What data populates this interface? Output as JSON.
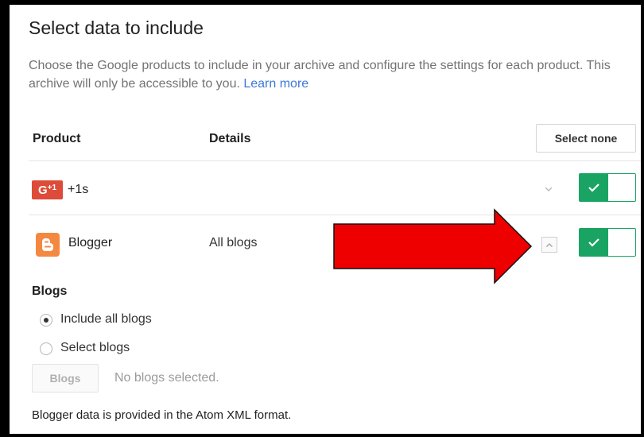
{
  "page": {
    "title": "Select data to include",
    "description": "Choose the Google products to include in your archive and configure the settings for each product. This archive will only be accessible to you.",
    "learn_more": "Learn more"
  },
  "table": {
    "headers": {
      "product": "Product",
      "details": "Details"
    },
    "select_none_label": "Select none",
    "rows": [
      {
        "icon": "google-plus-one-icon",
        "icon_text": "G",
        "icon_sup": "+1",
        "product": "+1s",
        "details": "",
        "expanded": false,
        "included": true
      },
      {
        "icon": "blogger-icon",
        "product": "Blogger",
        "details": "All blogs",
        "expanded": true,
        "included": true
      }
    ]
  },
  "blogger_options": {
    "section_title": "Blogs",
    "radio_options": [
      {
        "label": "Include all blogs",
        "checked": true
      },
      {
        "label": "Select blogs",
        "checked": false
      }
    ],
    "blogs_button_label": "Blogs",
    "no_selection_text": "No blogs selected.",
    "format_note": "Blogger data is provided in the Atom XML format."
  },
  "colors": {
    "toggle_on": "#19a463",
    "link": "#3c78d8",
    "annotation_arrow": "#ee0000",
    "google_plus": "#dd4b39",
    "blogger": "#f48840"
  }
}
